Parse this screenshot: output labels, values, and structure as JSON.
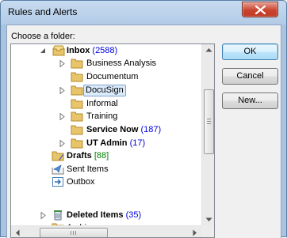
{
  "window": {
    "title": "Rules and Alerts"
  },
  "dialog": {
    "choose_label": "Choose a folder:",
    "buttons": {
      "ok": "OK",
      "cancel": "Cancel",
      "new": "New..."
    }
  },
  "tree": [
    {
      "label": "Inbox",
      "count": "(2588)",
      "bold": true,
      "expanded": true,
      "level": 0,
      "icon": "inbox-icon"
    },
    {
      "label": "Business Analysis",
      "count": "",
      "bold": false,
      "expandable": true,
      "level": 1,
      "icon": "folder-icon"
    },
    {
      "label": "Documentum",
      "count": "",
      "bold": false,
      "expandable": false,
      "level": 1,
      "icon": "folder-icon"
    },
    {
      "label": "DocuSign",
      "count": "",
      "bold": false,
      "expandable": true,
      "level": 1,
      "icon": "folder-icon",
      "selected": true
    },
    {
      "label": "Informal",
      "count": "",
      "bold": false,
      "expandable": false,
      "level": 1,
      "icon": "folder-icon"
    },
    {
      "label": "Training",
      "count": "",
      "bold": false,
      "expandable": true,
      "level": 1,
      "icon": "folder-icon"
    },
    {
      "label": "Service Now",
      "count": "(187)",
      "bold": true,
      "expandable": false,
      "level": 1,
      "icon": "folder-icon"
    },
    {
      "label": "UT Admin",
      "count": "(17)",
      "bold": true,
      "expandable": true,
      "level": 1,
      "icon": "folder-icon"
    },
    {
      "label": "Drafts",
      "count": "[88]",
      "bold": true,
      "expandable": false,
      "level": 0,
      "icon": "drafts-icon"
    },
    {
      "label": "Sent Items",
      "count": "",
      "bold": false,
      "expandable": false,
      "level": 0,
      "icon": "sent-items-icon"
    },
    {
      "label": "Outbox",
      "count": "",
      "bold": false,
      "expandable": false,
      "level": 0,
      "icon": "outbox-icon"
    },
    {
      "label": "Deleted Items",
      "count": "(35)",
      "bold": true,
      "expandable": true,
      "level": 0,
      "icon": "deleted-items-icon"
    },
    {
      "label": "Archive",
      "count": "",
      "bold": false,
      "expandable": false,
      "level": 0,
      "icon": "folder-icon"
    }
  ],
  "colors": {
    "count_blue": "#0000e0",
    "drafts_green": "#008000",
    "folder_yellow": "#e8c46a",
    "title_bar": "#b9d1ea"
  }
}
